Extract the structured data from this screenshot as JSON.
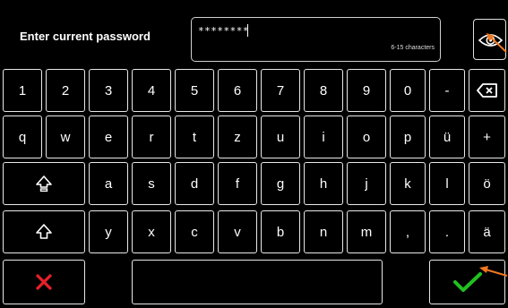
{
  "dialog": {
    "title": "Enter current password",
    "password_masked": "********",
    "hint": "6-15 characters"
  },
  "icons": {
    "show_password": "eye-icon",
    "backspace": "backspace-icon",
    "caps_lock": "caps-lock-icon",
    "shift": "shift-icon",
    "cancel": "cross-icon",
    "confirm": "checkmark-icon",
    "annotation": "arrow-icon"
  },
  "colors": {
    "background": "#000000",
    "key_border": "#e8e8e8",
    "cancel": "#e8202a",
    "confirm": "#22c020",
    "annotation": "#f07820"
  },
  "keyboard": {
    "row1": [
      "1",
      "2",
      "3",
      "4",
      "5",
      "6",
      "7",
      "8",
      "9",
      "0",
      "-"
    ],
    "row2": [
      "q",
      "w",
      "e",
      "r",
      "t",
      "z",
      "u",
      "i",
      "o",
      "p",
      "ü",
      "+"
    ],
    "row3": [
      "a",
      "s",
      "d",
      "f",
      "g",
      "h",
      "j",
      "k",
      "l",
      "ö"
    ],
    "row4": [
      "y",
      "x",
      "c",
      "v",
      "b",
      "n",
      "m",
      ",",
      ".",
      "ä"
    ]
  }
}
